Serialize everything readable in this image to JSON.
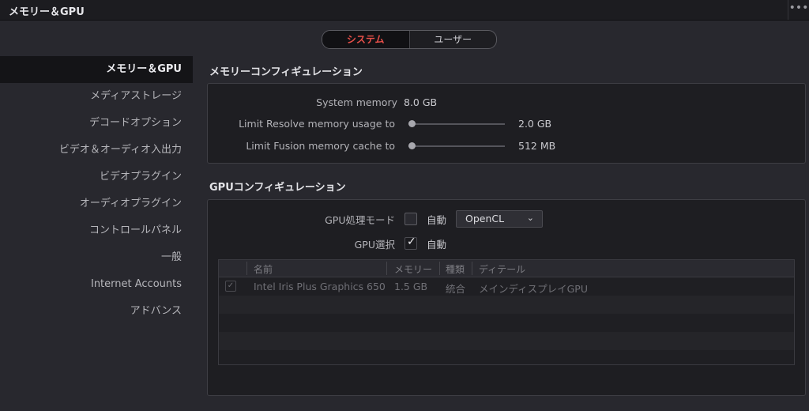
{
  "window": {
    "title": "メモリー＆GPU",
    "more_label": "•••"
  },
  "tabs": [
    {
      "label": "システム",
      "active": true
    },
    {
      "label": "ユーザー",
      "active": false
    }
  ],
  "sidebar": {
    "items": [
      {
        "label": "メモリー＆GPU",
        "active": true
      },
      {
        "label": "メディアストレージ"
      },
      {
        "label": "デコードオプション"
      },
      {
        "label": "ビデオ＆オーディオ入出力"
      },
      {
        "label": "ビデオプラグイン"
      },
      {
        "label": "オーディオプラグイン"
      },
      {
        "label": "コントロールパネル"
      },
      {
        "label": "一般"
      },
      {
        "label": "Internet Accounts"
      },
      {
        "label": "アドバンス"
      }
    ]
  },
  "memory": {
    "section_title": "メモリーコンフィギュレーション",
    "system_memory_label": "System memory",
    "system_memory_value": "8.0 GB",
    "resolve_label": "Limit Resolve memory usage to",
    "resolve_value": "2.0 GB",
    "resolve_level": 0,
    "fusion_label": "Limit Fusion memory cache to",
    "fusion_value": "512 MB",
    "fusion_level": 0
  },
  "gpu": {
    "section_title": "GPUコンフィギュレーション",
    "mode_label": "GPU処理モード",
    "mode_auto_label": "自動",
    "mode_auto_checked": false,
    "mode_dropdown_value": "OpenCL",
    "select_label": "GPU選択",
    "select_auto_label": "自動",
    "select_auto_checked": true,
    "table": {
      "columns": [
        "名前",
        "メモリー",
        "種類",
        "ディテール"
      ],
      "rows": [
        {
          "checked": true,
          "name": "Intel Iris Plus Graphics 650",
          "memory": "1.5 GB",
          "type": "統合",
          "detail": "メインディスプレイGPU"
        }
      ]
    }
  },
  "colors": {
    "accent": "#e8504a",
    "background": "#28282e",
    "panel": "#1e1e22"
  }
}
